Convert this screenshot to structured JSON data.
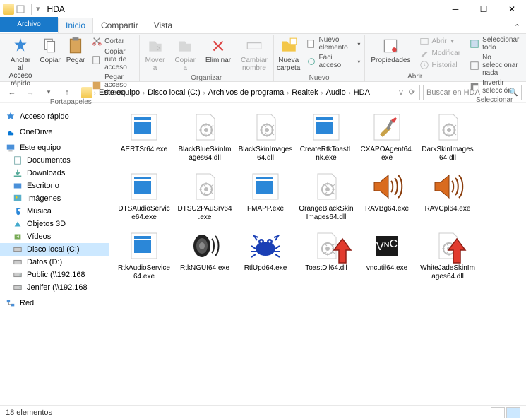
{
  "window": {
    "title": "HDA"
  },
  "tabs": {
    "file": "Archivo",
    "home": "Inicio",
    "share": "Compartir",
    "view": "Vista"
  },
  "ribbon": {
    "pin": "Anclar al\nAcceso rápido",
    "copy": "Copiar",
    "paste": "Pegar",
    "cut": "Cortar",
    "copyPath": "Copiar ruta de acceso",
    "pasteShortcut": "Pegar acceso directo",
    "moveTo": "Mover\na",
    "copyTo": "Copiar\na",
    "delete": "Eliminar",
    "rename": "Cambiar\nnombre",
    "newFolder": "Nueva\ncarpeta",
    "newItem": "Nuevo elemento",
    "easyAccess": "Fácil acceso",
    "properties": "Propiedades",
    "open": "Abrir",
    "modify": "Modificar",
    "history": "Historial",
    "selectAll": "Seleccionar todo",
    "selectNone": "No seleccionar nada",
    "invert": "Invertir selección",
    "g_clipboard": "Portapapeles",
    "g_organize": "Organizar",
    "g_new": "Nuevo",
    "g_open": "Abrir",
    "g_select": "Seleccionar"
  },
  "breadcrumbs": [
    "Este equipo",
    "Disco local (C:)",
    "Archivos de programa",
    "Realtek",
    "Audio",
    "HDA"
  ],
  "search_placeholder": "Buscar en HDA",
  "sidebar": {
    "quick": "Acceso rápido",
    "onedrive": "OneDrive",
    "thispc": "Este equipo",
    "items": [
      "Documentos",
      "Downloads",
      "Escritorio",
      "Imágenes",
      "Música",
      "Objetos 3D",
      "Vídeos",
      "Disco local (C:)",
      "Datos (D:)",
      "Public (\\\\192.168",
      "Jenifer (\\\\192.168"
    ],
    "network": "Red"
  },
  "files": [
    {
      "name": "AERTSr64.exe",
      "icon": "appwin"
    },
    {
      "name": "BlackBlueSkinImages64.dll",
      "icon": "dll"
    },
    {
      "name": "BlackSkinImages64.dll",
      "icon": "dll"
    },
    {
      "name": "CreateRtkToastLnk.exe",
      "icon": "appwin"
    },
    {
      "name": "CXAPOAgent64.exe",
      "icon": "tools"
    },
    {
      "name": "DarkSkinImages64.dll",
      "icon": "dll"
    },
    {
      "name": "DTSAudioService64.exe",
      "icon": "appwin"
    },
    {
      "name": "DTSU2PAuSrv64.exe",
      "icon": "dll"
    },
    {
      "name": "FMAPP.exe",
      "icon": "appwin"
    },
    {
      "name": "OrangeBlackSkinImages64.dll",
      "icon": "dll"
    },
    {
      "name": "RAVBg64.exe",
      "icon": "speaker-orange"
    },
    {
      "name": "RAVCpl64.exe",
      "icon": "speaker-orange"
    },
    {
      "name": "RtkAudioService64.exe",
      "icon": "appwin"
    },
    {
      "name": "RtkNGUI64.exe",
      "icon": "speaker-dark"
    },
    {
      "name": "RtlUpd64.exe",
      "icon": "crab"
    },
    {
      "name": "ToastDll64.dll",
      "icon": "dll"
    },
    {
      "name": "vncutil64.exe",
      "icon": "vnc"
    },
    {
      "name": "WhiteJadeSkinImages64.dll",
      "icon": "dll"
    }
  ],
  "status": {
    "count": "18 elementos"
  }
}
